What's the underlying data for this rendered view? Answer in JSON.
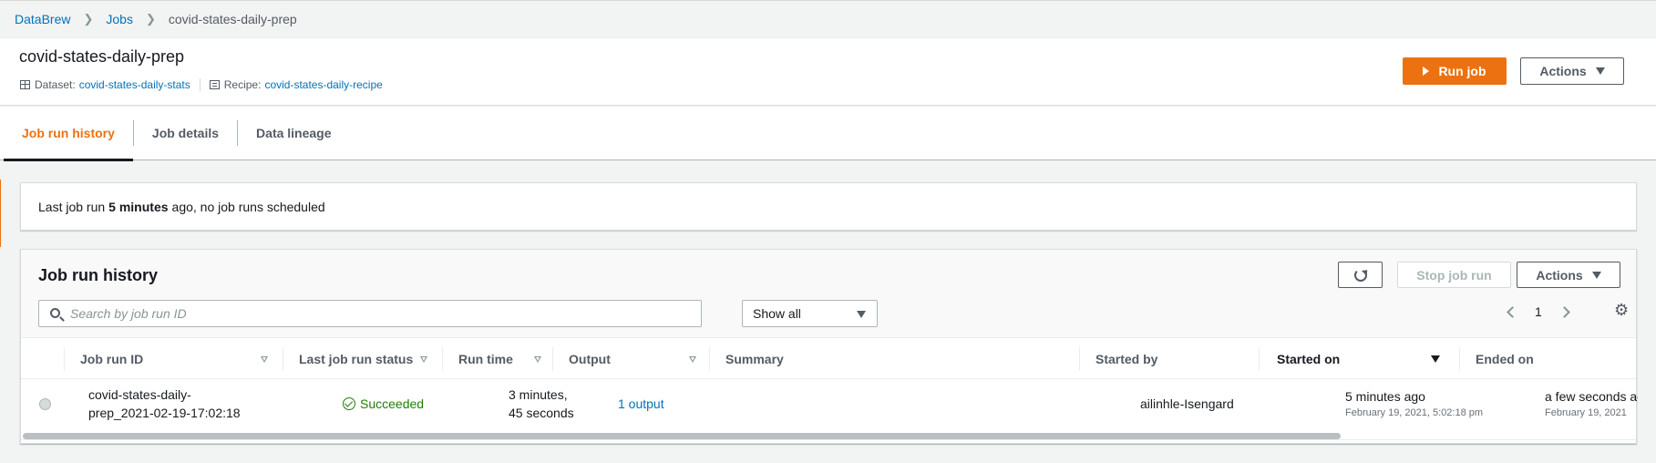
{
  "breadcrumb": {
    "items": [
      "DataBrew",
      "Jobs"
    ],
    "current": "covid-states-daily-prep"
  },
  "header": {
    "title": "covid-states-daily-prep",
    "dataset_label": "Dataset:",
    "dataset_value": "covid-states-daily-stats",
    "recipe_label": "Recipe:",
    "recipe_value": "covid-states-daily-recipe",
    "run_job_label": "Run job",
    "actions_label": "Actions"
  },
  "tabs": [
    {
      "label": "Job run history",
      "active": true
    },
    {
      "label": "Job details",
      "active": false
    },
    {
      "label": "Data lineage",
      "active": false
    }
  ],
  "banner": {
    "prefix": "Last job run",
    "emphasis": "5 minutes",
    "suffix": "ago, no job runs scheduled"
  },
  "panel": {
    "title": "Job run history",
    "search_placeholder": "Search by job run ID",
    "filter_value": "Show all",
    "stop_label": "Stop job run",
    "actions_label": "Actions",
    "page_number": "1"
  },
  "table": {
    "columns": [
      "Job run ID",
      "Last job run status",
      "Run time",
      "Output",
      "Summary",
      "Started by",
      "Started on",
      "Ended on"
    ],
    "rows": [
      {
        "job_run_id_line1": "covid-states-daily-",
        "job_run_id_line2": "prep_2021-02-19-17:02:18",
        "status": "Succeeded",
        "run_time_line1": "3 minutes,",
        "run_time_line2": "45 seconds",
        "output": "1 output",
        "summary": "",
        "started_by": "ailinhle-Isengard",
        "started_on": "5 minutes ago",
        "started_on_detail": "February 19, 2021, 5:02:18 pm",
        "ended_on": "a few seconds ago",
        "ended_on_detail": "February 19, 2021"
      }
    ]
  },
  "colors": {
    "accent": "#ec7211",
    "link": "#0073bb",
    "success": "#1d8102"
  }
}
